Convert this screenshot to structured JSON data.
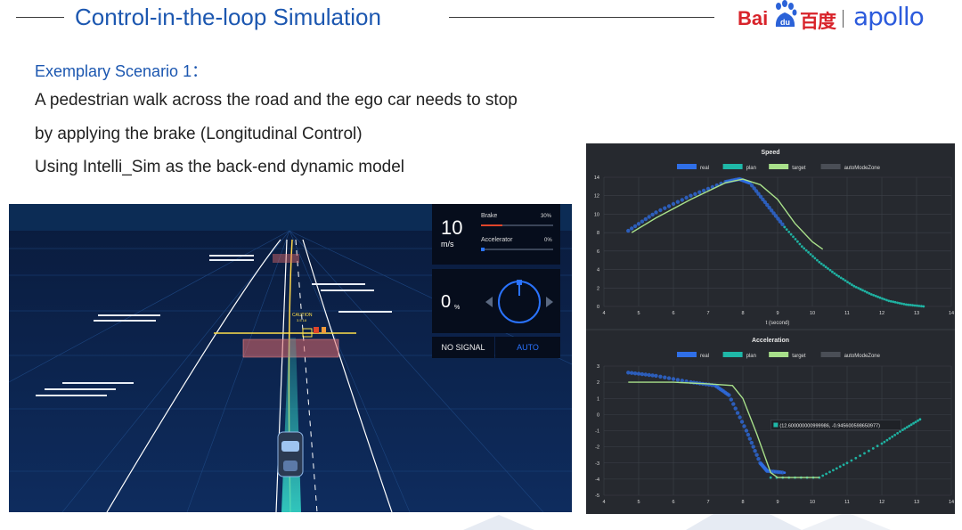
{
  "slide": {
    "title": "Control-in-the-loop Simulation",
    "scenario": "Exemplary Scenario 1：",
    "lines": [
      "A pedestrian walk across the road and the ego car needs to stop",
      "by applying the brake (Longitudinal Control)",
      "Using Intelli_Sim as the back-end dynamic model"
    ]
  },
  "logo": {
    "bai": "Bai",
    "du": "du",
    "cn": "百度",
    "apollo": "apollo"
  },
  "sim": {
    "speed_value": "10",
    "speed_unit": "m/s",
    "brake_label": "Brake",
    "brake_pct": "30%",
    "brake_level": 0.3,
    "accel_label": "Accelerator",
    "accel_pct": "0%",
    "accel_level": 0.0,
    "steer_value": "0",
    "steer_unit": "%",
    "signal": "NO SIGNAL",
    "mode": "AUTO",
    "caution_label": "CAUTION",
    "caution_sub": "3.5 18",
    "colors": {
      "brake": "#e0452a",
      "accel": "#2a73ff",
      "lane": "#35d6c6"
    }
  },
  "chart_data": [
    {
      "type": "line",
      "title": "Speed",
      "xlabel": "t (second)",
      "ylabel": "",
      "xlim": [
        4,
        14
      ],
      "ylim": [
        0,
        14
      ],
      "xticks": [
        4,
        5,
        6,
        7,
        8,
        9,
        10,
        11,
        12,
        13,
        14
      ],
      "yticks": [
        0,
        2,
        4,
        6,
        8,
        10,
        12,
        14
      ],
      "legend": [
        "real",
        "plan",
        "target",
        "autoModeZone"
      ],
      "series": [
        {
          "name": "real",
          "color": "#2f6fe8",
          "points": [
            [
              4.7,
              8.2
            ],
            [
              5.5,
              10.2
            ],
            [
              6.5,
              12.0
            ],
            [
              7.5,
              13.5
            ],
            [
              7.9,
              13.8
            ],
            [
              8.2,
              13.4
            ],
            [
              8.7,
              11.0
            ],
            [
              9.2,
              8.6
            ]
          ]
        },
        {
          "name": "plan",
          "color": "#1fb8a8",
          "points": [
            [
              9.2,
              8.6
            ],
            [
              9.7,
              6.5
            ],
            [
              10.2,
              4.8
            ],
            [
              10.7,
              3.4
            ],
            [
              11.2,
              2.2
            ],
            [
              11.7,
              1.3
            ],
            [
              12.2,
              0.6
            ],
            [
              12.7,
              0.2
            ],
            [
              13.2,
              0.0
            ]
          ]
        },
        {
          "name": "target",
          "color": "#a8e08a",
          "points": [
            [
              4.8,
              8.0
            ],
            [
              5.5,
              9.6
            ],
            [
              6.5,
              11.6
            ],
            [
              7.5,
              13.4
            ],
            [
              8.0,
              13.8
            ],
            [
              8.5,
              13.2
            ],
            [
              9.0,
              11.6
            ],
            [
              9.5,
              9.0
            ],
            [
              10.0,
              7.0
            ],
            [
              10.3,
              6.2
            ]
          ]
        }
      ]
    },
    {
      "type": "line",
      "title": "Acceleration",
      "xlabel": "",
      "ylabel": "",
      "xlim": [
        4,
        14
      ],
      "ylim": [
        -5,
        3
      ],
      "xticks": [
        4,
        5,
        6,
        7,
        8,
        9,
        10,
        11,
        12,
        13,
        14
      ],
      "yticks": [
        -5,
        -4,
        -3,
        -2,
        -1,
        0,
        1,
        2,
        3
      ],
      "legend": [
        "real",
        "plan",
        "target",
        "autoModeZone"
      ],
      "tooltip": "(12.600000000999986, -0.945600598650977)",
      "tooltip_point": [
        12.6,
        -0.9456
      ],
      "series": [
        {
          "name": "real",
          "color": "#2f6fe8",
          "points": [
            [
              4.7,
              2.6
            ],
            [
              5.5,
              2.4
            ],
            [
              6.5,
              2.0
            ],
            [
              7.2,
              1.8
            ],
            [
              7.6,
              1.2
            ],
            [
              8.1,
              -1.0
            ],
            [
              8.5,
              -3.0
            ],
            [
              8.7,
              -3.5
            ],
            [
              9.2,
              -3.6
            ]
          ]
        },
        {
          "name": "plan",
          "color": "#1fb8a8",
          "points": [
            [
              8.8,
              -3.9
            ],
            [
              10.2,
              -3.9
            ],
            [
              11.0,
              -3.0
            ],
            [
              12.0,
              -1.8
            ],
            [
              12.6,
              -0.95
            ],
            [
              13.1,
              -0.3
            ]
          ]
        },
        {
          "name": "target",
          "color": "#a8e08a",
          "points": [
            [
              4.7,
              2.0
            ],
            [
              6.0,
              2.0
            ],
            [
              7.0,
              1.9
            ],
            [
              7.7,
              1.8
            ],
            [
              8.0,
              1.0
            ],
            [
              8.4,
              -1.2
            ],
            [
              8.8,
              -3.6
            ],
            [
              9.0,
              -3.9
            ],
            [
              10.2,
              -3.9
            ]
          ]
        }
      ]
    }
  ]
}
